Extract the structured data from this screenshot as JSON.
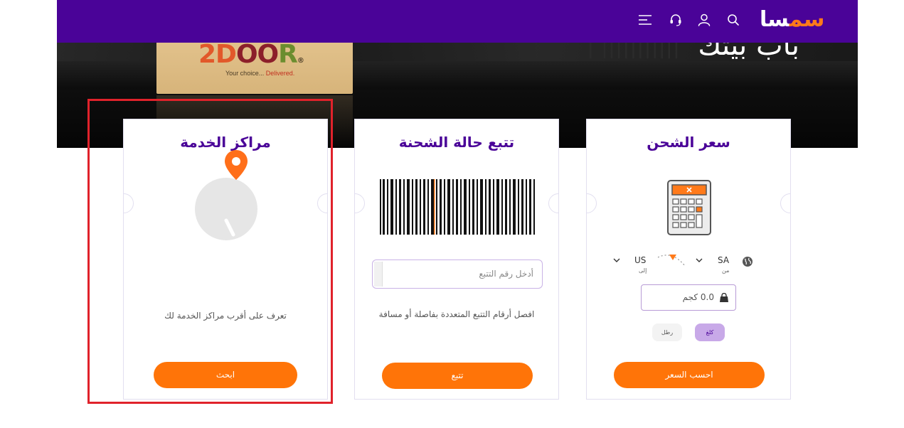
{
  "hero": {
    "headline": "باب بيتك",
    "box_logo": {
      "part1": "2D",
      "part2": "OO",
      "part3": "R",
      "reg": "®"
    },
    "box_tagline": {
      "text": "Your choice... ",
      "highlight": "Delivered."
    }
  },
  "navbar": {
    "logo": {
      "part1": "سم",
      "part2": "سا"
    },
    "icons": [
      "search-icon",
      "user-icon",
      "headset-icon",
      "menu-icon"
    ]
  },
  "cards": {
    "shipping_price": {
      "title": "سعر الشحن",
      "from_code": "SA",
      "from_label": "من",
      "to_code": "US",
      "to_label": "إلى",
      "weight_value": "0.0 كجم",
      "unit_kg": "كلغ",
      "unit_lb": "رطل",
      "button": "احسب السعر"
    },
    "tracking": {
      "title": "تتبع حالة الشحنة",
      "input_placeholder": "أدخل رقم التتبع",
      "hint": "افصل أرقام التتبع المتعددة بفاصلة أو مسافة",
      "button": "تتبع"
    },
    "service_centers": {
      "title": "مراكز الخدمة",
      "description": "تعرف على أقرب مراكز الخدمة لك",
      "button": "ابحث"
    }
  },
  "colors": {
    "brand_purple": "#4a0398",
    "brand_orange": "#ff7408",
    "highlight_red": "#e0222b"
  }
}
